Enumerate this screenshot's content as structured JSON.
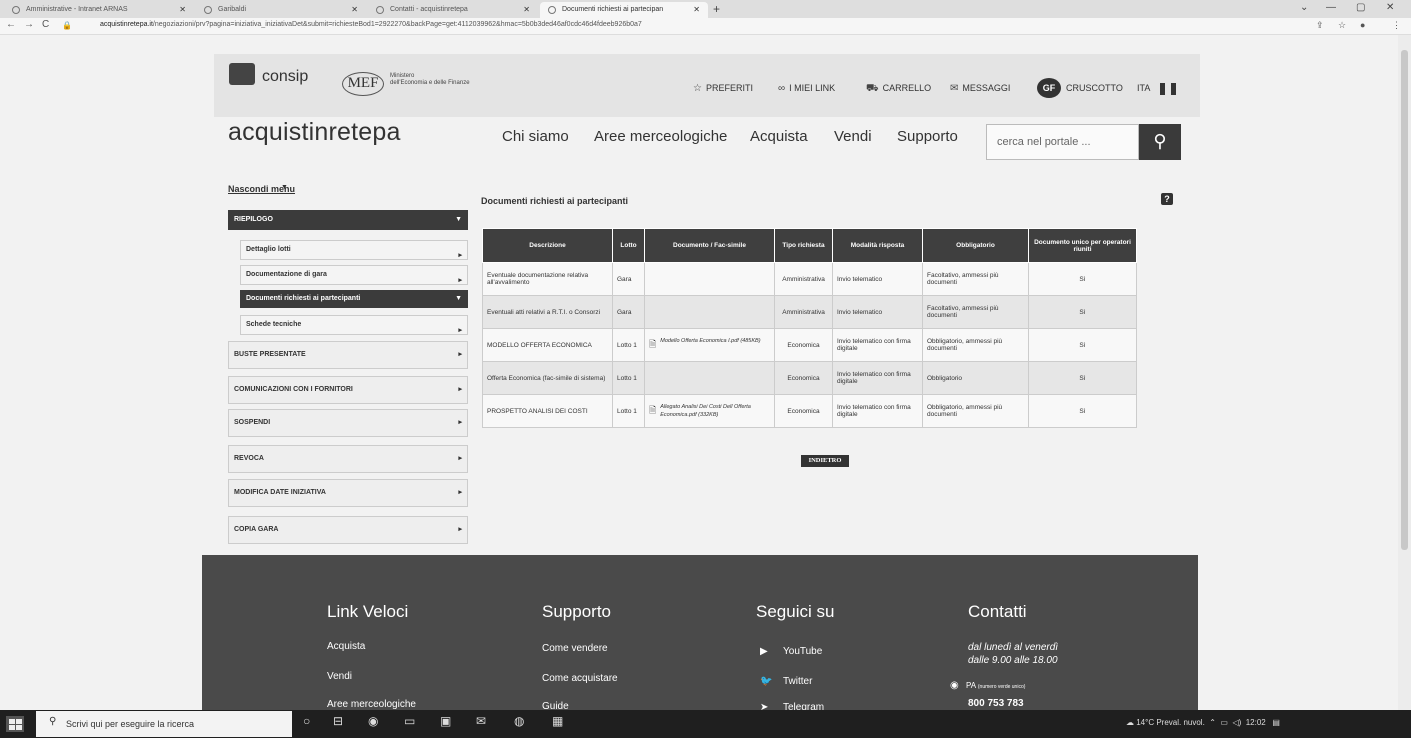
{
  "browser": {
    "tabs": [
      {
        "title": "Amministrative - Intranet ARNAS",
        "active": false
      },
      {
        "title": "Garibaldi",
        "active": false
      },
      {
        "title": "Contatti - acquistinretepa",
        "active": false
      },
      {
        "title": "Documenti richiesti ai partecipan",
        "active": true
      }
    ],
    "url_domain": "acquistinretepa.it",
    "url_path": "/negoziazioni/prv?pagina=iniziativa_iniziativaDet&submit=richiesteBod1=2922270&backPage=get:4112039962&hmac=5b0b3ded46af0cdc46d4fdeeb926b0a7"
  },
  "header": {
    "consip": "consip",
    "mef": "MEF",
    "ministero_line1": "Ministero",
    "ministero_line2": "dell'Economia e delle Finanze",
    "links": [
      "PREFERITI",
      "I MIEI LINK",
      "CARRELLO",
      "MESSAGGI"
    ],
    "user_initials": "GF",
    "cruscotto": "CRUSCOTTO",
    "lang": "ITA",
    "brand": "acquistinretepa",
    "nav": [
      "Chi siamo",
      "Aree merceologiche",
      "Acquista",
      "Vendi",
      "Supporto"
    ],
    "search_placeholder": "cerca nel portale ..."
  },
  "sidebar": {
    "hide": "Nascondi menu",
    "riepilogo": "RIEPILOGO",
    "sub": [
      "Dettaglio lotti",
      "Documentazione di gara",
      "Documenti richiesti ai partecipanti",
      "Schede tecniche"
    ],
    "items": [
      "BUSTE PRESENTATE",
      "COMUNICAZIONI CON I FORNITORI",
      "SOSPENDI",
      "REVOCA",
      "MODIFICA DATE INIZIATIVA",
      "COPIA GARA"
    ]
  },
  "main": {
    "title": "Documenti richiesti ai partecipanti",
    "help": "?",
    "headers": [
      "Descrizione",
      "Lotto",
      "Documento / Fac-simile",
      "Tipo richiesta",
      "Modalità risposta",
      "Obbligatorio",
      "Documento unico per operatori riuniti"
    ],
    "rows": [
      {
        "descr": "Eventuale documentazione relativa all'avvalimento",
        "lotto": "Gara",
        "doc": "",
        "tipo": "Amministrativa",
        "modalita": "Invio telematico",
        "obbl": "Facoltativo, ammessi più documenti",
        "unico": "Sì"
      },
      {
        "descr": "Eventuali atti relativi a R.T.I. o Consorzi",
        "lotto": "Gara",
        "doc": "",
        "tipo": "Amministrativa",
        "modalita": "Invio telematico",
        "obbl": "Facoltativo, ammessi più documenti",
        "unico": "Sì"
      },
      {
        "descr": "MODELLO OFFERTA ECONOMICA",
        "lotto": "Lotto 1",
        "doc": "Modello Offerta Economica I.pdf (485KB)",
        "tipo": "Economica",
        "modalita": "Invio telematico con firma digitale",
        "obbl": "Obbligatorio, ammessi più documenti",
        "unico": "Sì"
      },
      {
        "descr": "Offerta Economica (fac-simile di sistema)",
        "lotto": "Lotto 1",
        "doc": "",
        "tipo": "Economica",
        "modalita": "Invio telematico con firma digitale",
        "obbl": "Obbligatorio",
        "unico": "Sì"
      },
      {
        "descr": "PROSPETTO ANALISI DEI COSTI",
        "lotto": "Lotto 1",
        "doc": "Allegato Analisi Dei Costi Dell Offerta Economica.pdf (332KB)",
        "tipo": "Economica",
        "modalita": "Invio telematico con firma digitale",
        "obbl": "Obbligatorio, ammessi più documenti",
        "unico": "Sì"
      }
    ],
    "back": "INDIETRO"
  },
  "footer": {
    "col1": {
      "title": "Link Veloci",
      "items": [
        "Acquista",
        "Vendi",
        "Aree merceologiche"
      ]
    },
    "col2": {
      "title": "Supporto",
      "items": [
        "Come vendere",
        "Come acquistare",
        "Guide"
      ]
    },
    "col3": {
      "title": "Seguici su",
      "items": [
        "YouTube",
        "Twitter",
        "Telegram"
      ]
    },
    "col4": {
      "title": "Contatti",
      "hours1": "dal lunedì al venerdì",
      "hours2": "dalle 9.00 alle 18.00",
      "pa": "PA",
      "pa_note": "(numero verde unico)",
      "phone": "800 753 783"
    }
  },
  "taskbar": {
    "search": "Scrivi qui per eseguire la ricerca",
    "weather": "14°C Preval. nuvol.",
    "time": "12:02"
  }
}
